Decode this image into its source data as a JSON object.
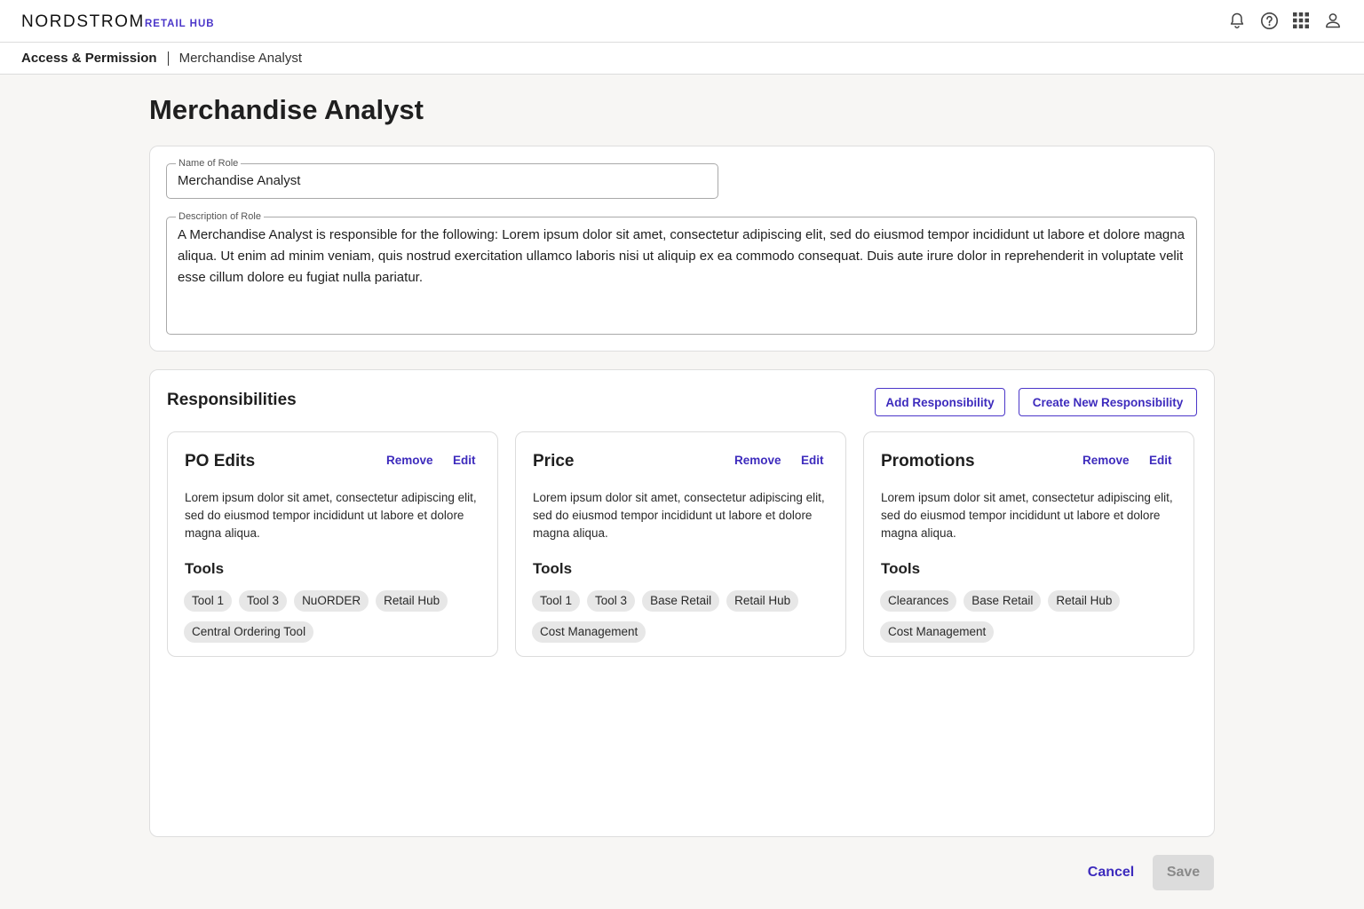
{
  "app": {
    "brand": "NORDSTROM",
    "product": "RETAIL HUB"
  },
  "topbar": {
    "icons": [
      "bell-icon",
      "help-icon",
      "apps-grid-icon",
      "user-icon"
    ]
  },
  "breadcrumb": {
    "parent": "Access & Permission",
    "current": "Merchandise Analyst"
  },
  "page": {
    "title": "Merchandise Analyst"
  },
  "role_form": {
    "name_label": "Name of Role",
    "name_value": "Merchandise Analyst",
    "description_label": "Description of Role",
    "description_value": "A Merchandise Analyst is responsible for the following: Lorem ipsum dolor sit amet, consectetur adipiscing elit, sed do eiusmod tempor incididunt ut labore et dolore magna aliqua. Ut enim ad minim veniam, quis nostrud exercitation ullamco laboris nisi ut aliquip ex ea commodo consequat. Duis aute irure dolor in reprehenderit in voluptate velit esse cillum dolore eu fugiat nulla pariatur."
  },
  "responsibilities": {
    "title": "Responsibilities",
    "add_label": "Add Responsibility",
    "create_label": "Create New Responsibility",
    "items": [
      {
        "title": "PO Edits",
        "remove_label": "Remove",
        "edit_label": "Edit",
        "description": "Lorem ipsum dolor sit amet, consectetur adipiscing elit, sed do eiusmod tempor incididunt ut labore et dolore magna aliqua.",
        "tools_title": "Tools",
        "tools": [
          "Tool 1",
          "Tool 3",
          "NuORDER",
          "Retail Hub",
          "Central Ordering Tool"
        ]
      },
      {
        "title": "Price",
        "remove_label": "Remove",
        "edit_label": "Edit",
        "description": "Lorem ipsum dolor sit amet, consectetur adipiscing elit, sed do eiusmod tempor incididunt ut labore et dolore magna aliqua.",
        "tools_title": "Tools",
        "tools": [
          "Tool 1",
          "Tool 3",
          "Base Retail",
          "Retail Hub",
          "Cost Management"
        ]
      },
      {
        "title": "Promotions",
        "remove_label": "Remove",
        "edit_label": "Edit",
        "description": "Lorem ipsum dolor sit amet, consectetur adipiscing elit, sed do eiusmod tempor incididunt ut labore et dolore magna aliqua.",
        "tools_title": "Tools",
        "tools": [
          "Clearances",
          "Base Retail",
          "Retail Hub",
          "Cost Management"
        ]
      }
    ]
  },
  "footer": {
    "cancel_label": "Cancel",
    "save_label": "Save"
  },
  "colors": {
    "accent": "#3d2bbd",
    "page_bg": "#f7f6f4",
    "chip_bg": "#e7e7e7",
    "disabled_bg": "#dcdcdc"
  }
}
